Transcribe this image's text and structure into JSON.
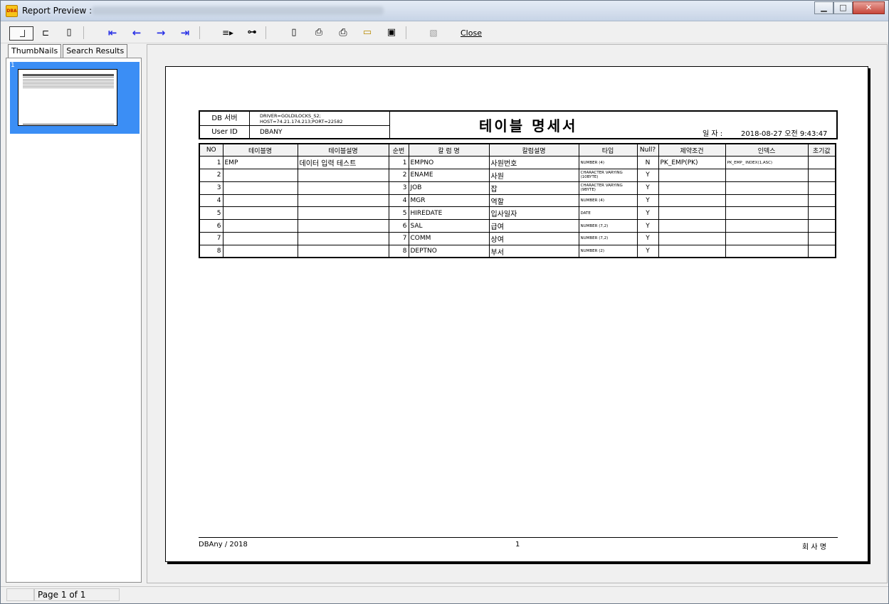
{
  "window": {
    "title": "Report Preview :",
    "app_icon": "DBA"
  },
  "toolbar": {
    "zoom_icon": "page-width-icon",
    "close_label": "Close"
  },
  "tabs": [
    {
      "label": "ThumbNails",
      "active": true
    },
    {
      "label": "Search Results",
      "active": false
    }
  ],
  "thumbnail": {
    "number": "1"
  },
  "report": {
    "header": {
      "db_server_label": "DB 서버",
      "db_server_value": "DRIVER=GOLDILOCKS_S2; HOST=74.21.174.213;PORT=22582",
      "user_label": "User  ID",
      "user_value": "DBANY",
      "title": "테이블 명세서",
      "date_label": "일  자 :",
      "date_value": "2018-08-27 오전 9:43:47"
    },
    "columns": [
      "NO",
      "테이블명",
      "테이블설명",
      "순번",
      "칼 럼 명",
      "칼럼설명",
      "타입",
      "Null?",
      "제약조건",
      "인덱스",
      "초기값"
    ],
    "rows": [
      {
        "no": "1",
        "table": "EMP",
        "table_desc": "데이터 입력 테스트",
        "seq": "1",
        "column": "EMPNO",
        "col_desc": "사원번호",
        "type": "NUMBER (4)",
        "nullable": "N",
        "constraint": "PK_EMP(PK)",
        "index": "PK_EMP_ INDEX(1,ASC)",
        "default": ""
      },
      {
        "no": "2",
        "table": "",
        "table_desc": "",
        "seq": "2",
        "column": "ENAME",
        "col_desc": "사원",
        "type": "CHARACTER VARYING (10BYTE)",
        "nullable": "Y",
        "constraint": "",
        "index": "",
        "default": ""
      },
      {
        "no": "3",
        "table": "",
        "table_desc": "",
        "seq": "3",
        "column": "JOB",
        "col_desc": "잡",
        "type": "CHARACTER VARYING (9BYTE)",
        "nullable": "Y",
        "constraint": "",
        "index": "",
        "default": ""
      },
      {
        "no": "4",
        "table": "",
        "table_desc": "",
        "seq": "4",
        "column": "MGR",
        "col_desc": "역할",
        "type": "NUMBER (4)",
        "nullable": "Y",
        "constraint": "",
        "index": "",
        "default": ""
      },
      {
        "no": "5",
        "table": "",
        "table_desc": "",
        "seq": "5",
        "column": "HIREDATE",
        "col_desc": "입사일자",
        "type": "DATE",
        "nullable": "Y",
        "constraint": "",
        "index": "",
        "default": ""
      },
      {
        "no": "6",
        "table": "",
        "table_desc": "",
        "seq": "6",
        "column": "SAL",
        "col_desc": "급여",
        "type": "NUMBER (7,2)",
        "nullable": "Y",
        "constraint": "",
        "index": "",
        "default": ""
      },
      {
        "no": "7",
        "table": "",
        "table_desc": "",
        "seq": "7",
        "column": "COMM",
        "col_desc": "상여",
        "type": "NUMBER (7,2)",
        "nullable": "Y",
        "constraint": "",
        "index": "",
        "default": ""
      },
      {
        "no": "8",
        "table": "",
        "table_desc": "",
        "seq": "8",
        "column": "DEPTNO",
        "col_desc": "부서",
        "type": "NUMBER (2)",
        "nullable": "Y",
        "constraint": "",
        "index": "",
        "default": ""
      }
    ],
    "footer": {
      "left": "DBAny  /  2018",
      "page": "1",
      "right": "회 사 명"
    }
  },
  "status": {
    "page_text": "Page 1 of 1"
  }
}
